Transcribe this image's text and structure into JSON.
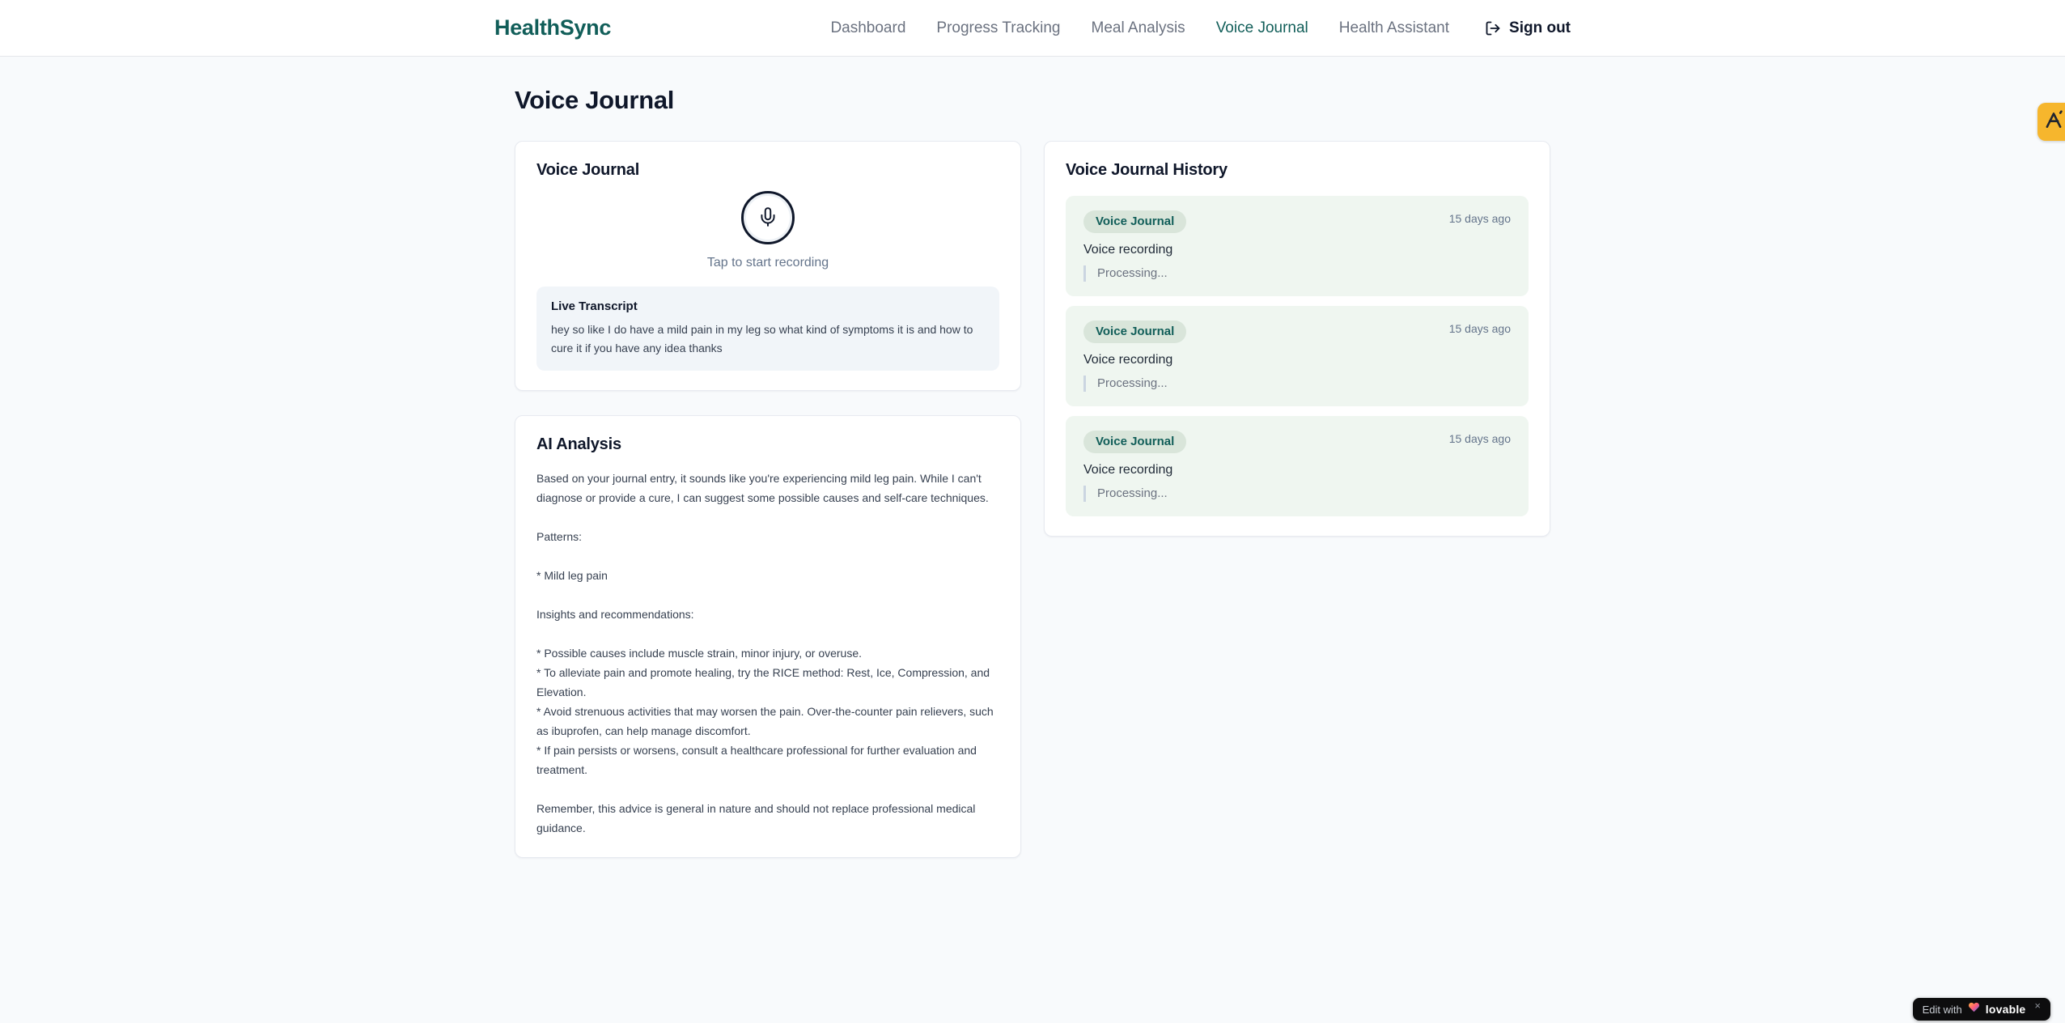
{
  "brand": {
    "name": "HealthSync"
  },
  "nav": {
    "items": [
      {
        "label": "Dashboard",
        "active": false
      },
      {
        "label": "Progress Tracking",
        "active": false
      },
      {
        "label": "Meal Analysis",
        "active": false
      },
      {
        "label": "Voice Journal",
        "active": true
      },
      {
        "label": "Health Assistant",
        "active": false
      }
    ],
    "sign_out_label": "Sign out"
  },
  "page": {
    "title": "Voice Journal"
  },
  "recorder": {
    "card_title": "Voice Journal",
    "tap_hint": "Tap to start recording",
    "transcript_label": "Live Transcript",
    "transcript_text": "hey so like I do have a mild pain in my leg so what kind of symptoms it is and how to cure it if you have any idea thanks"
  },
  "analysis": {
    "card_title": "AI Analysis",
    "body": "Based on your journal entry, it sounds like you're experiencing mild leg pain. While I can't diagnose or provide a cure, I can suggest some possible causes and self-care techniques.\n\nPatterns:\n\n* Mild leg pain\n\nInsights and recommendations:\n\n* Possible causes include muscle strain, minor injury, or overuse.\n* To alleviate pain and promote healing, try the RICE method: Rest, Ice, Compression, and Elevation.\n* Avoid strenuous activities that may worsen the pain. Over-the-counter pain relievers, such as ibuprofen, can help manage discomfort.\n* If pain persists or worsens, consult a healthcare professional for further evaluation and treatment.\n\nRemember, this advice is general in nature and should not replace professional medical guidance."
  },
  "history": {
    "card_title": "Voice Journal History",
    "entries": [
      {
        "badge": "Voice Journal",
        "time": "15 days ago",
        "title": "Voice recording",
        "status": "Processing..."
      },
      {
        "badge": "Voice Journal",
        "time": "15 days ago",
        "title": "Voice recording",
        "status": "Processing..."
      },
      {
        "badge": "Voice Journal",
        "time": "15 days ago",
        "title": "Voice recording",
        "status": "Processing..."
      }
    ]
  },
  "overlays": {
    "edit_badge": {
      "prefix": "Edit with",
      "brand": "lovable",
      "close": "×"
    }
  },
  "colors": {
    "accent_teal": "#115e59",
    "page_background": "#f8fafc",
    "history_entry_background": "#eff6f0",
    "badge_background": "#d9e5da",
    "side_badge_amber": "#f6b62d",
    "edit_pill_background": "#0d0d0e",
    "muted_text": "#64748b"
  }
}
